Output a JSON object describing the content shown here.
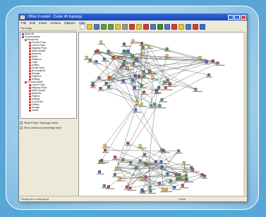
{
  "window": {
    "title": "Office 6 model - Cedar 45 topology"
  },
  "menu": [
    "File",
    "Edit",
    "Insert",
    "Actions",
    "Options",
    "Help"
  ],
  "left_toolbar_label": "Topology",
  "tree": [
    {
      "label": "Model 80",
      "color": "#3a6cc8"
    },
    {
      "label": "Communication",
      "color": "#d23c3c"
    },
    {
      "label": "Resources",
      "color": "#3aa34c"
    },
    {
      "label": "Product Props",
      "color": "#d23c3c"
    },
    {
      "label": "Lumen Props",
      "color": "#d23c3c"
    },
    {
      "label": "Mapping Props",
      "color": "#d23c3c"
    },
    {
      "label": "Model update",
      "color": "#d23c3c"
    },
    {
      "label": "Networks",
      "color": "#d23c3c"
    },
    {
      "label": "Notes",
      "color": "#d23c3c"
    },
    {
      "label": "Platforms",
      "color": "#d23c3c"
    },
    {
      "label": "Trade",
      "color": "#d23c3c"
    },
    {
      "label": "Entities",
      "color": "#d23c3c"
    },
    {
      "label": "Global Parts",
      "color": "#d23c3c"
    },
    {
      "label": "Air conditions",
      "color": "#d23c3c"
    },
    {
      "label": "Storage",
      "color": "#d23c3c"
    },
    {
      "label": "Platforms",
      "color": "#d23c3c"
    },
    {
      "label": "Settings",
      "color": "#d23c3c"
    },
    {
      "label": "Communication",
      "color": "#d23c3c"
    },
    {
      "label": "Lumen Props",
      "color": "#d23c3c"
    },
    {
      "label": "Mapping Props",
      "color": "#d23c3c"
    },
    {
      "label": "Model update",
      "color": "#d23c3c"
    },
    {
      "label": "Networks",
      "color": "#d23c3c"
    },
    {
      "label": "Platform",
      "color": "#d23c3c"
    },
    {
      "label": "Settings",
      "color": "#d23c3c"
    },
    {
      "label": "Com levels",
      "color": "#d23c3c"
    },
    {
      "label": "Entities",
      "color": "#d23c3c"
    },
    {
      "label": "Storage",
      "color": "#d23c3c"
    },
    {
      "label": "Global",
      "color": "#d23c3c"
    }
  ],
  "options": [
    "Show Project Topology Labels",
    "Show values as percentage (bar)"
  ],
  "status": {
    "text": "Ready for a new input",
    "zoom": "Zoom"
  },
  "toolbar_icons": [
    "new-icon",
    "open-icon",
    "save-icon",
    "undo-icon",
    "redo-icon",
    "pencil-icon",
    "pointer-icon",
    "node-icon",
    "link-icon",
    "filter-icon",
    "grid-icon",
    "layout-icon",
    "chart-icon",
    "export-icon",
    "zoom-icon",
    "settings-icon",
    "back-icon",
    "help-icon"
  ],
  "colors": {
    "background": "#58a6d6",
    "titlebar": "#2d63d6",
    "accent_red": "#d23c3c",
    "accent_yellow": "#e6c334",
    "accent_blue": "#3a6cc8"
  }
}
